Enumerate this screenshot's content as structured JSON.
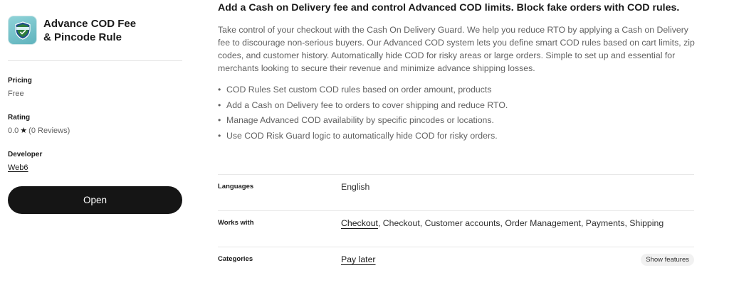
{
  "app": {
    "name": "Advance COD Fee & Pincode Rule",
    "icon": "shield-badge-icon",
    "brand_color": "#5fb3bd"
  },
  "sidebar": {
    "pricing": {
      "label": "Pricing",
      "value": "Free"
    },
    "rating": {
      "label": "Rating",
      "value": "0.0",
      "star": "★",
      "reviews": "(0 Reviews)"
    },
    "developer": {
      "label": "Developer",
      "value": "Web6"
    },
    "open_button": "Open"
  },
  "main": {
    "headline": "Add a Cash on Delivery fee and control Advanced COD limits. Block fake orders with COD rules.",
    "description": "Take control of your checkout with the Cash On Delivery Guard. We help you reduce RTO by applying a Cash on Delivery fee to discourage non-serious buyers. Our Advanced COD system lets you define smart COD rules based on cart limits, zip codes, and customer history. Automatically hide COD for risky areas or large orders. Simple to set up and essential for merchants looking to secure their revenue and minimize advance shipping losses.",
    "features": [
      "COD Rules Set custom COD rules based on order amount, products",
      "Add a Cash on Delivery fee to orders to cover shipping and reduce RTO.",
      "Manage Advanced COD availability by specific pincodes or locations.",
      "Use COD Risk Guard logic to automatically hide COD for risky orders."
    ],
    "details": {
      "languages": {
        "label": "Languages",
        "value": "English"
      },
      "works_with": {
        "label": "Works with",
        "link": "Checkout",
        "rest": ", Checkout, Customer accounts, Order Management, Payments, Shipping"
      },
      "categories": {
        "label": "Categories",
        "value": "Pay later",
        "button": "Show features"
      }
    }
  }
}
